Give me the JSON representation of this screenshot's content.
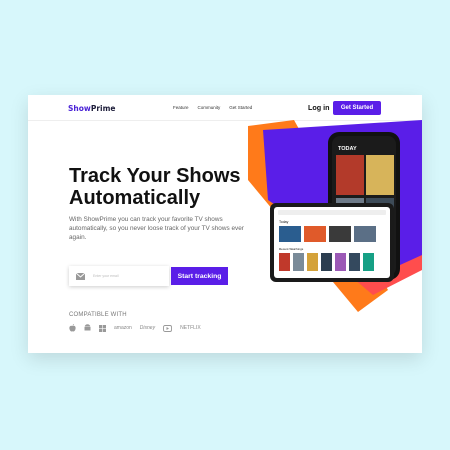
{
  "brand": {
    "part1": "Show",
    "part2": "Prime"
  },
  "nav": {
    "links": [
      "Feature",
      "Community",
      "Get Started"
    ],
    "login": "Log in",
    "get_started": "Get Started"
  },
  "hero": {
    "title_line1": "Track Your Shows",
    "title_line2": "Automatically",
    "subtitle": "With ShowPrime you can track your favorite TV shows automatically, so you never loose track of your TV shows ever again."
  },
  "form": {
    "email_placeholder": "Enter your email",
    "cta": "Start tracking"
  },
  "compatible": {
    "label": "COMPATIBLE WITH",
    "brands": [
      "apple",
      "android",
      "windows",
      "amazon",
      "Disney",
      "youtube",
      "NETFLIX"
    ]
  },
  "phone": {
    "heading": "TODAY"
  },
  "tablet": {
    "section1": "Today",
    "section2": "Recent Watchings"
  },
  "colors": {
    "accent": "#5a1ee8",
    "orange": "#ff7a1a",
    "coral": "#ff4d4d",
    "background": "#d7f7fb"
  }
}
